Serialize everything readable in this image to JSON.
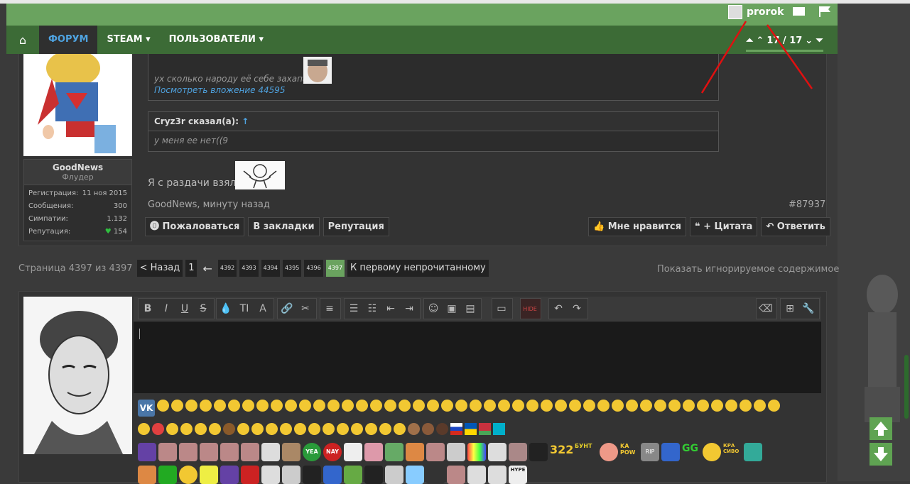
{
  "header": {
    "username": "prorok"
  },
  "nav": {
    "items": [
      {
        "label": "ФОРУМ",
        "active": true
      },
      {
        "label": "STEAM ▾",
        "active": false
      },
      {
        "label": "ПОЛЬЗОВАТЕЛИ ▾",
        "active": false
      }
    ],
    "page_indicator": "17 / 17"
  },
  "post": {
    "author_name": "GoodNews",
    "author_rank": "Флудер",
    "stats": [
      {
        "label": "Регистрация:",
        "value": "11 ноя 2015"
      },
      {
        "label": "Сообщения:",
        "value": "300"
      },
      {
        "label": "Симпатии:",
        "value": "1.132"
      },
      {
        "label": "Репутация:",
        "value": "154"
      }
    ],
    "quote1_text": "ух сколько народу её себе захапало",
    "quote1_link": "Посмотреть вложение 44595",
    "quote2_author": "Cryz3r сказал(а):",
    "quote2_arrow": "↑",
    "quote2_text": "у меня ее нет((9",
    "message": "Я с раздачи взял",
    "author_line": "GoodNews, минуту назад",
    "post_number": "#87937",
    "actions_left": [
      "Пожаловаться",
      "В закладки",
      "Репутация"
    ],
    "actions_right": [
      "Мне нравится",
      "+ Цитата",
      "Ответить"
    ]
  },
  "pagination": {
    "label": "Страница 4397 из 4397",
    "prev": "< Назад",
    "first": "1",
    "ellipsis_arrow": "←",
    "pages": [
      "4392",
      "4393",
      "4394",
      "4395",
      "4396",
      "4397"
    ],
    "current": "4397",
    "first_unread": "К первому непрочитанному",
    "show_ignored": "Показать игнорируемое содержимое"
  },
  "editor": {
    "vk_label": "VK",
    "emote_322": "322",
    "emote_bunt": "БУНТ",
    "emote_kapow": "KA POW",
    "emote_rip": "RIP",
    "emote_gg": "GG",
    "emote_krasivo": "КРА СИВО",
    "emote_yea": "YEA",
    "emote_nay": "NAY",
    "emote_hype": "HYPE",
    "emote_hide": "HIDE"
  },
  "colors": {
    "topbar": "#6aa35f",
    "navbar": "#3c6b36",
    "link": "#4fa3e0",
    "active_page": "#6aa35f"
  }
}
